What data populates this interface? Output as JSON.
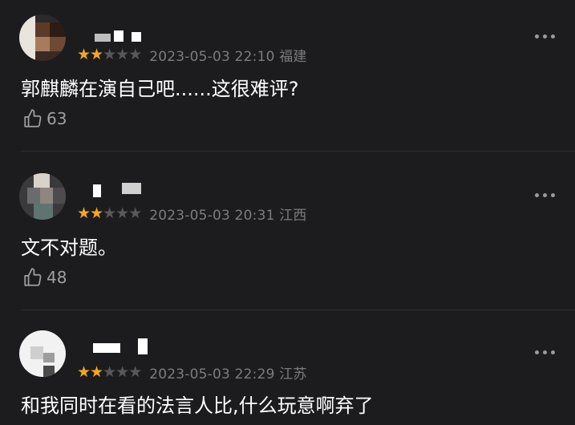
{
  "comments": [
    {
      "rating": 2,
      "rating_max": 5,
      "meta": "2023-05-03 22:10 福建",
      "text": "郭麒麟在演自己吧......这很难评?",
      "likes": "63"
    },
    {
      "rating": 2,
      "rating_max": 5,
      "meta": "2023-05-03 20:31 江西",
      "text": "文不对题。",
      "likes": "48"
    },
    {
      "rating": 2,
      "rating_max": 5,
      "meta": "2023-05-03 22:29 江苏",
      "text": "和我同时在看的法言人比,什么玩意啊弃了",
      "likes": ""
    }
  ],
  "colors": {
    "background": "#1c1c1e",
    "star_filled": "#f5a623",
    "star_empty": "#58585c",
    "meta_text": "#7c7c80"
  },
  "icons": {
    "like": "thumbs-up-outline-icon",
    "more": "more-dots-icon"
  }
}
